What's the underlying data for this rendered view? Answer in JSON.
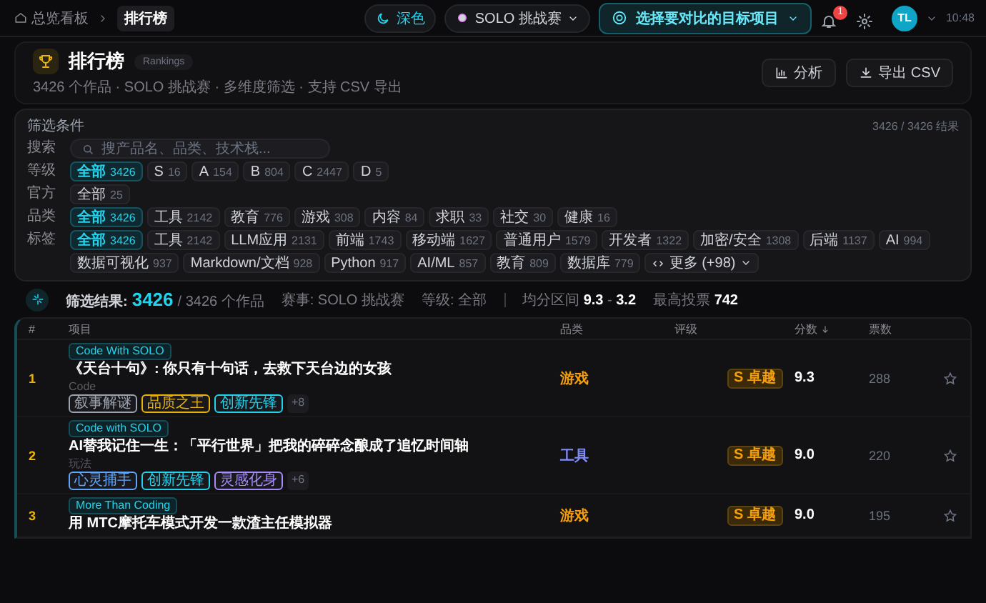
{
  "topbar": {
    "breadcrumb": [
      {
        "label": "总览看板",
        "kind": "home"
      },
      {
        "label": "排行榜",
        "kind": "current"
      }
    ],
    "theme": {
      "label": "深色"
    },
    "event_select": {
      "value": "SOLO 挑战赛"
    },
    "compare_select": {
      "placeholder": "选择要对比的目标项目"
    },
    "notifications": {
      "badge": "1"
    },
    "avatar": {
      "initials": "TL"
    },
    "clock": "10:48"
  },
  "header": {
    "title": "排行榜",
    "badge": "Rankings",
    "subtitle": "3426 个作品 · SOLO 挑战赛 · 多维度筛选 · 支持 CSV 导出",
    "buttons": [
      {
        "label": "分析",
        "kind": "chart"
      },
      {
        "label": "导出 CSV",
        "kind": "download"
      }
    ]
  },
  "filters": {
    "title": "筛选条件",
    "result_count": "3426 / 3426 结果",
    "search": {
      "label": "搜索",
      "placeholder": "搜产品名、品类、技术栈..."
    },
    "groups": [
      {
        "label": "等级",
        "options": [
          {
            "label": "全部",
            "count": "3426",
            "selected": true
          },
          {
            "label": "S",
            "count": "16",
            "selected": false
          },
          {
            "label": "A",
            "count": "154",
            "selected": false
          },
          {
            "label": "B",
            "count": "804",
            "selected": false
          },
          {
            "label": "C",
            "count": "2447",
            "selected": false
          },
          {
            "label": "D",
            "count": "5",
            "selected": false
          }
        ]
      },
      {
        "label": "官方",
        "options": [
          {
            "label": "全部",
            "count": "25",
            "selected": false
          }
        ]
      },
      {
        "label": "品类",
        "options": [
          {
            "label": "全部",
            "count": "3426",
            "selected": true
          },
          {
            "label": "工具",
            "count": "2142",
            "selected": false
          },
          {
            "label": "教育",
            "count": "776",
            "selected": false
          },
          {
            "label": "游戏",
            "count": "308",
            "selected": false
          },
          {
            "label": "内容",
            "count": "84",
            "selected": false
          },
          {
            "label": "求职",
            "count": "33",
            "selected": false
          },
          {
            "label": "社交",
            "count": "30",
            "selected": false
          },
          {
            "label": "健康",
            "count": "16",
            "selected": false
          }
        ]
      },
      {
        "label": "标签",
        "options": [
          {
            "label": "全部",
            "count": "3426",
            "selected": true
          },
          {
            "label": "工具",
            "count": "2142",
            "selected": false
          },
          {
            "label": "LLM应用",
            "count": "2131",
            "selected": false
          },
          {
            "label": "前端",
            "count": "1743",
            "selected": false
          },
          {
            "label": "移动端",
            "count": "1627",
            "selected": false
          },
          {
            "label": "普通用户",
            "count": "1579",
            "selected": false
          },
          {
            "label": "开发者",
            "count": "1322",
            "selected": false
          },
          {
            "label": "加密/安全",
            "count": "1308",
            "selected": false
          },
          {
            "label": "后端",
            "count": "1137",
            "selected": false
          },
          {
            "label": "AI",
            "count": "994",
            "selected": false
          },
          {
            "label": "数据可视化",
            "count": "937",
            "selected": false
          },
          {
            "label": "Markdown/文档",
            "count": "928",
            "selected": false
          },
          {
            "label": "Python",
            "count": "917",
            "selected": false
          },
          {
            "label": "AI/ML",
            "count": "857",
            "selected": false
          },
          {
            "label": "教育",
            "count": "809",
            "selected": false
          },
          {
            "label": "数据库",
            "count": "779",
            "selected": false
          }
        ],
        "more": "更多 (+98)"
      }
    ]
  },
  "summary": {
    "label": "筛选结果:",
    "count": "3426",
    "total": "/ 3426 个作品",
    "event": "赛事: SOLO 挑战赛",
    "grade": "等级: 全部",
    "score_range": "均分区间 **9.3** - **3.2**",
    "max_votes": "最高投票 **742**"
  },
  "table": {
    "columns": [
      {
        "label": "#",
        "sorted": false
      },
      {
        "label": "项目",
        "sorted": false
      },
      {
        "label": "品类",
        "sorted": false
      },
      {
        "label": "评级",
        "sorted": false
      },
      {
        "label": "分数",
        "sorted": true
      },
      {
        "label": "票数",
        "sorted": false
      }
    ],
    "rows": [
      {
        "rank": "1",
        "track": "Code With SOLO",
        "title": "《天台十句》: 你只有十句话，去救下天台边的女孩",
        "subtitle": "Code",
        "tags": [
          {
            "label": "叙事解谜",
            "color": "#9ca3af"
          },
          {
            "label": "品质之王",
            "color": "#eab308"
          },
          {
            "label": "创新先锋",
            "color": "#22d3ee"
          }
        ],
        "more": "+8",
        "category": {
          "label": "游戏",
          "color": "#f59e0b"
        },
        "rating": "S 卓越",
        "score": "9.3",
        "votes": "288"
      },
      {
        "rank": "2",
        "track": "Code with SOLO",
        "title": "AI替我记住一生：「平行世界」把我的碎碎念酿成了追忆时间轴",
        "subtitle": "玩法",
        "tags": [
          {
            "label": "心灵捕手",
            "color": "#60a5fa"
          },
          {
            "label": "创新先锋",
            "color": "#22d3ee"
          },
          {
            "label": "灵感化身",
            "color": "#a78bfa"
          }
        ],
        "more": "+6",
        "category": {
          "label": "工具",
          "color": "#818cf8"
        },
        "rating": "S 卓越",
        "score": "9.0",
        "votes": "220"
      },
      {
        "rank": "3",
        "track": "More Than Coding",
        "title": "用 MTC摩托车模式开发一款渣主任模拟器",
        "category": {
          "label": "游戏",
          "color": "#f59e0b"
        },
        "rating": "S 卓越",
        "score": "9.0",
        "votes": "195"
      }
    ]
  }
}
